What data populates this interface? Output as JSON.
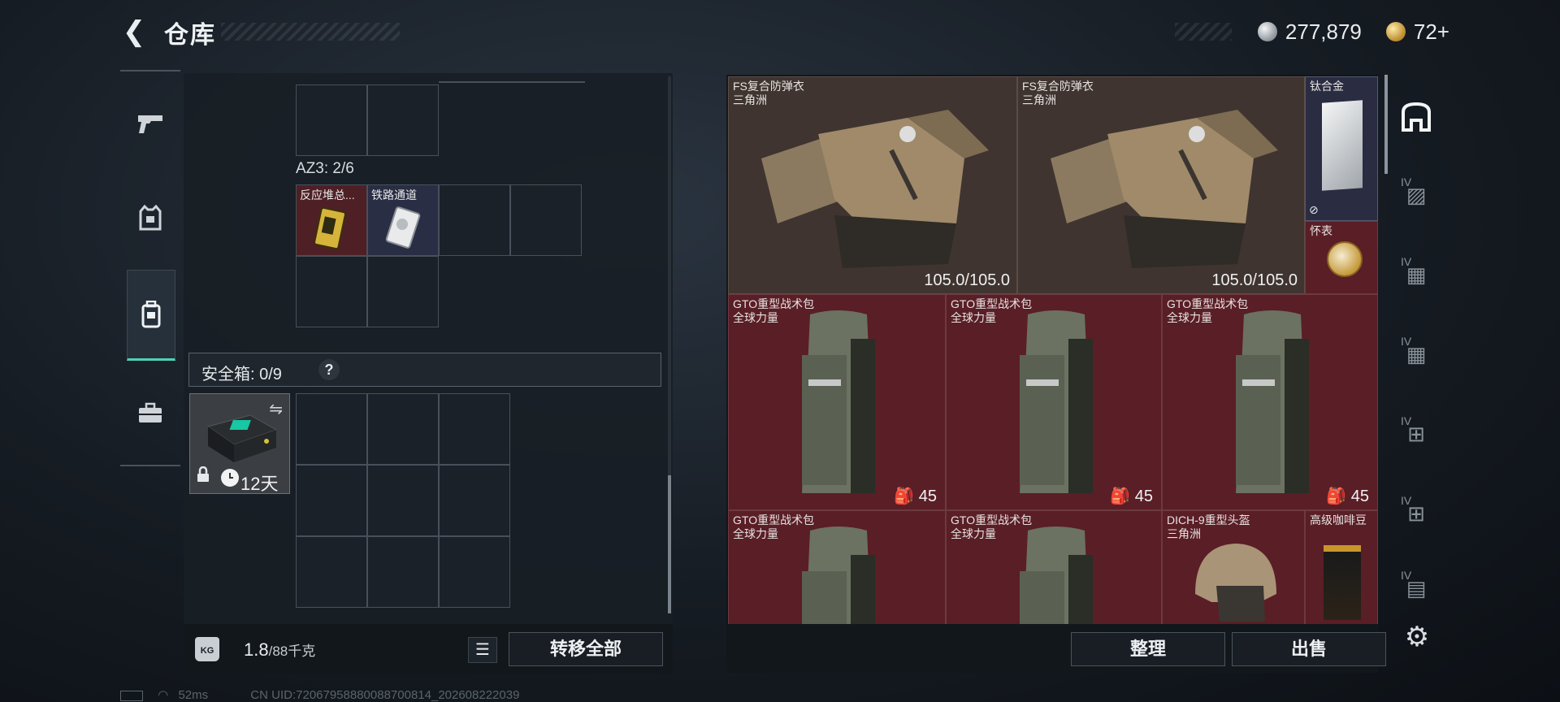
{
  "header": {
    "title": "仓库",
    "silver_amount": "277,879",
    "gold_amount": "72+"
  },
  "left_nav": {
    "items": [
      {
        "icon": "pistol-icon"
      },
      {
        "icon": "vest-icon"
      },
      {
        "icon": "backpack-icon"
      },
      {
        "icon": "briefcase-icon"
      }
    ],
    "active_index": 2
  },
  "container": {
    "az3_label": "AZ3: 2/6",
    "items": [
      {
        "label": "反应堆总...",
        "color": "red"
      },
      {
        "label": "铁路通道",
        "color": "blue"
      }
    ]
  },
  "safebox": {
    "label": "安全箱: 0/9",
    "help": "?",
    "days": "12天"
  },
  "bottom_left": {
    "weight_value": "1.8",
    "weight_max": "/88千克",
    "kg_icon_text": "KG",
    "transfer_all": "转移全部"
  },
  "stash": {
    "items": [
      {
        "name": "FS复合防弹衣",
        "sub": "三角洲",
        "value": "105.0/105.0"
      },
      {
        "name": "FS复合防弹衣",
        "sub": "三角洲",
        "value": "105.0/105.0"
      },
      {
        "name": "钛合金",
        "sub": ""
      },
      {
        "name": "怀表",
        "sub": ""
      },
      {
        "name": "GTO重型战术包",
        "sub": "全球力量",
        "capacity": "45"
      },
      {
        "name": "GTO重型战术包",
        "sub": "全球力量",
        "capacity": "45"
      },
      {
        "name": "GTO重型战术包",
        "sub": "全球力量",
        "capacity": "45"
      },
      {
        "name": "GTO重型战术包",
        "sub": "全球力量"
      },
      {
        "name": "GTO重型战术包",
        "sub": "全球力量"
      },
      {
        "name": "DICH-9重型头盔",
        "sub": "三角洲"
      },
      {
        "name": "高级咖啡豆",
        "sub": ""
      }
    ],
    "sort_button": "整理",
    "sell_button": "出售"
  },
  "right_nav": {
    "items": [
      {
        "icon": "stash-home-icon",
        "active": true
      },
      {
        "icon": "stash-tab-1-icon",
        "label": "IV"
      },
      {
        "icon": "stash-tab-2-icon",
        "label": "IV"
      },
      {
        "icon": "stash-tab-3-icon",
        "label": "IV"
      },
      {
        "icon": "stash-tab-4-icon",
        "label": "IV"
      },
      {
        "icon": "stash-tab-5-icon",
        "label": "IV"
      },
      {
        "icon": "stash-tab-6-icon",
        "label": "IV"
      }
    ]
  },
  "status_bar": {
    "ping": "52ms",
    "uid": "CN UID:72067958880088700814_202608222039"
  },
  "colors": {
    "accent": "#4fd1b5",
    "item_red": "#5a1e26",
    "item_vest": "#3f3430",
    "item_silver": "#2a2c42"
  }
}
